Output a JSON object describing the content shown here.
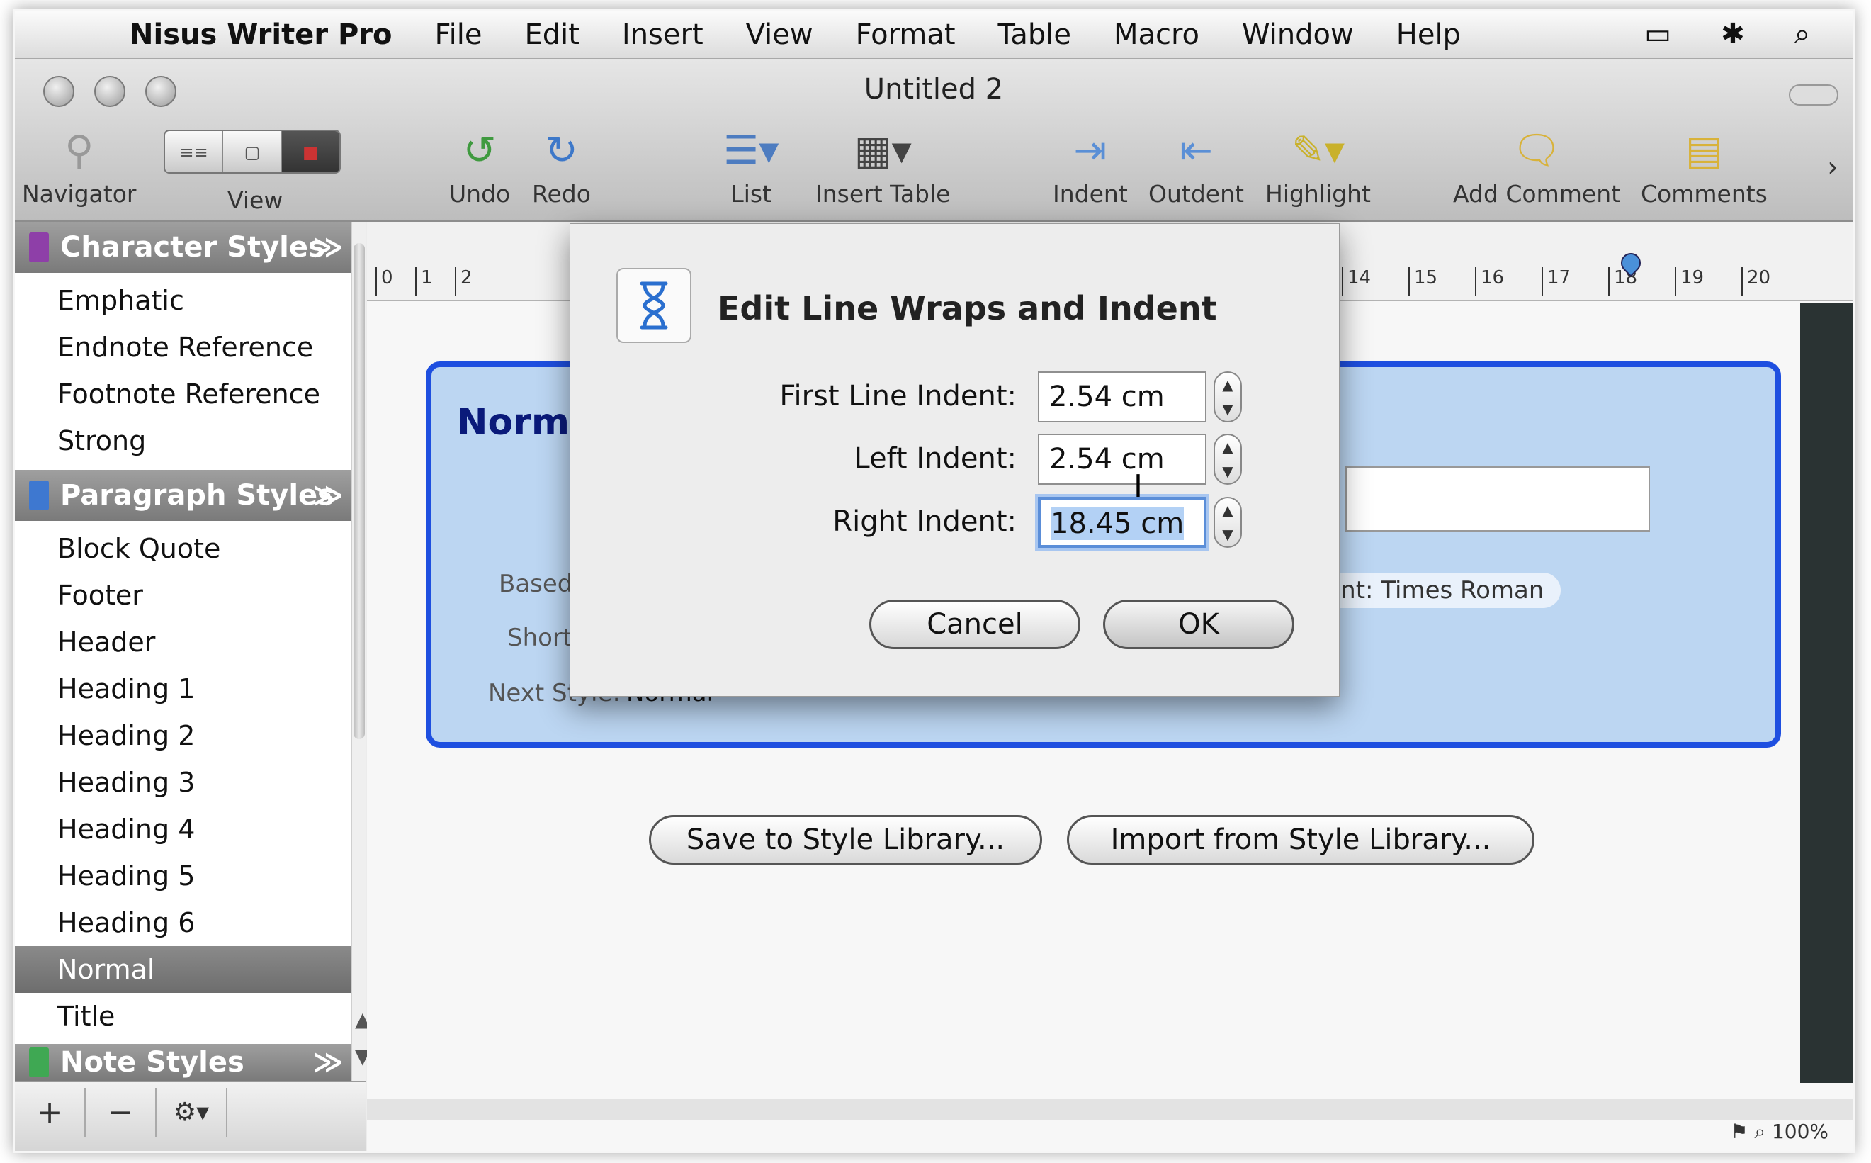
{
  "menubar": {
    "app": "Nisus Writer Pro",
    "items": [
      "File",
      "Edit",
      "Insert",
      "View",
      "Format",
      "Table",
      "Macro",
      "Window",
      "Help"
    ]
  },
  "window": {
    "title": "Untitled 2"
  },
  "toolbar": {
    "navigator": "Navigator",
    "view": "View",
    "undo": "Undo",
    "redo": "Redo",
    "list": "List",
    "insert_table": "Insert Table",
    "indent": "Indent",
    "outdent": "Outdent",
    "highlight": "Highlight",
    "add_comment": "Add Comment",
    "comments": "Comments"
  },
  "sidebar": {
    "character_header": "Character Styles",
    "character_items": [
      "Emphatic",
      "Endnote Reference",
      "Footnote Reference",
      "Strong"
    ],
    "paragraph_header": "Paragraph Styles",
    "paragraph_items": [
      "Block Quote",
      "Footer",
      "Header",
      "Heading 1",
      "Heading 2",
      "Heading 3",
      "Heading 4",
      "Heading 5",
      "Heading 6",
      "Normal",
      "Title"
    ],
    "selected": "Normal",
    "note_header": "Note Styles",
    "add": "+",
    "remove": "−",
    "gear": "⚙▾"
  },
  "ruler": {
    "labels": [
      "0",
      "1",
      "2",
      "14",
      "15",
      "16",
      "17",
      "18",
      "19",
      "20"
    ]
  },
  "style_panel": {
    "title": "Normal",
    "based_on_label": "Based On:",
    "shortcut_label": "Shortcut:",
    "next_style_label": "Next Style:",
    "next_style_value": "Normal",
    "font_chip": "Font: Times Roman"
  },
  "library": {
    "save": "Save to Style Library...",
    "import": "Import from Style Library..."
  },
  "dialog": {
    "title": "Edit Line Wraps and Indent",
    "first_line_label": "First Line Indent:",
    "first_line_value": "2.54 cm",
    "left_label": "Left Indent:",
    "left_value": "2.54 cm",
    "right_label": "Right Indent:",
    "right_value": "18.45 cm",
    "cancel": "Cancel",
    "ok": "OK"
  },
  "status": {
    "zoom": "100%"
  },
  "colors": {
    "panel_border": "#1e4fe0",
    "panel_fill": "#bcd6f2",
    "title_text": "#0a1a7a"
  }
}
